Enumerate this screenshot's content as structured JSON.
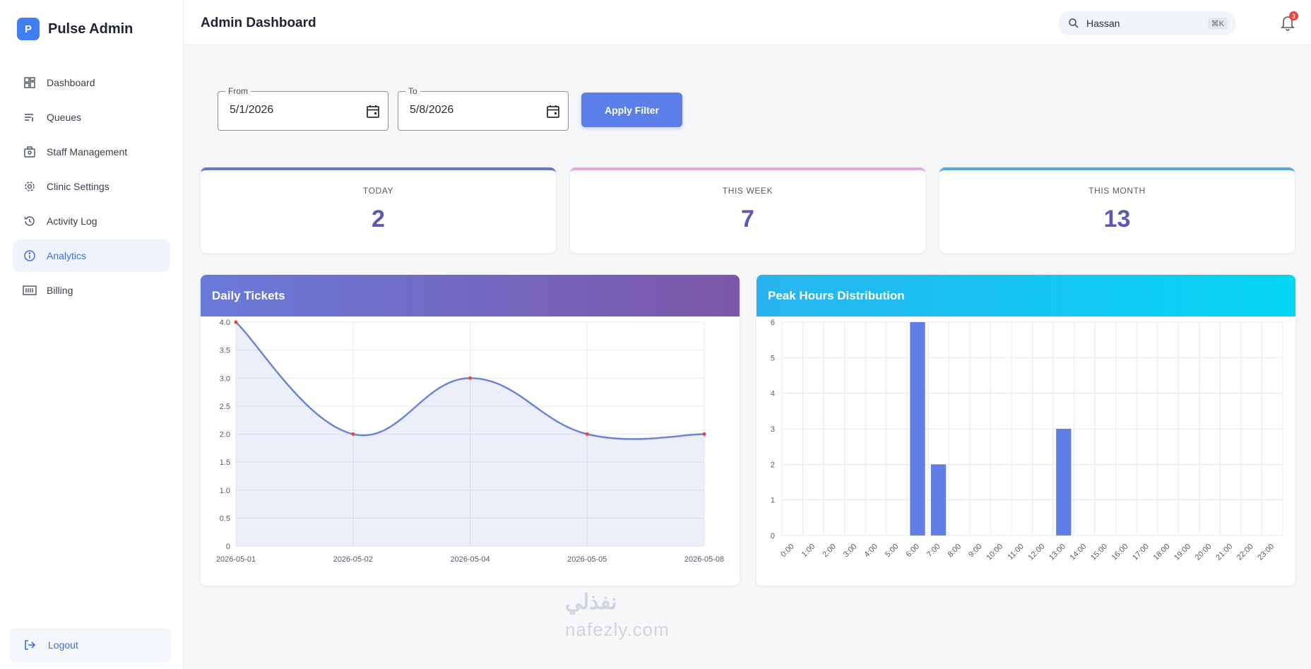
{
  "brand": {
    "logo_letter": "P",
    "name": "Pulse Admin"
  },
  "sidebar": {
    "items": [
      {
        "label": "Dashboard",
        "icon": "dashboard-icon"
      },
      {
        "label": "Queues",
        "icon": "queue-icon"
      },
      {
        "label": "Staff Management",
        "icon": "staff-icon"
      },
      {
        "label": "Clinic Settings",
        "icon": "gear-icon"
      },
      {
        "label": "Activity Log",
        "icon": "history-icon"
      },
      {
        "label": "Analytics",
        "icon": "info-icon",
        "active": true
      },
      {
        "label": "Billing",
        "icon": "billing-icon"
      }
    ],
    "logout_label": "Logout"
  },
  "header": {
    "title": "Admin Dashboard",
    "search_value": "Hassan",
    "search_shortcut": "⌘K",
    "notification_count": "3"
  },
  "filters": {
    "from_label": "From",
    "from_value": "5/1/2026",
    "to_label": "To",
    "to_value": "5/8/2026",
    "apply_label": "Apply Filter"
  },
  "stats": [
    {
      "label": "TODAY",
      "value": "2",
      "color": "#6a75d8"
    },
    {
      "label": "THIS WEEK",
      "value": "7",
      "color": "#e2a6e6"
    },
    {
      "label": "THIS MONTH",
      "value": "13",
      "color": "#4ea8ec"
    }
  ],
  "colors": {
    "accent": "#5b7fe8",
    "line": "#6b84d8",
    "bar": "#5f7ee6"
  },
  "watermark": {
    "text": "نفذلي",
    "domain": "nafezly.com"
  },
  "chart_data": [
    {
      "type": "line",
      "title": "Daily Tickets",
      "x": [
        "2026-05-01",
        "2026-05-02",
        "2026-05-04",
        "2026-05-05",
        "2026-05-08"
      ],
      "values": [
        4,
        2,
        3,
        2,
        2
      ],
      "ylim": [
        0,
        4
      ],
      "yticks": [
        "0",
        "0.5",
        "1.0",
        "1.5",
        "2.0",
        "2.5",
        "3.0",
        "3.5",
        "4.0"
      ],
      "fill": true,
      "grid": true
    },
    {
      "type": "bar",
      "title": "Peak Hours Distribution",
      "categories": [
        "0:00",
        "1:00",
        "2:00",
        "3:00",
        "4:00",
        "5:00",
        "6:00",
        "7:00",
        "8:00",
        "9:00",
        "10:00",
        "11:00",
        "12:00",
        "13:00",
        "14:00",
        "15:00",
        "16:00",
        "17:00",
        "18:00",
        "19:00",
        "20:00",
        "21:00",
        "22:00",
        "23:00"
      ],
      "values": [
        0,
        0,
        0,
        0,
        0,
        0,
        6,
        2,
        0,
        0,
        0,
        0,
        0,
        3,
        0,
        0,
        0,
        0,
        0,
        0,
        0,
        0,
        0,
        0
      ],
      "ylim": [
        0,
        6
      ],
      "yticks": [
        "0",
        "1",
        "2",
        "3",
        "4",
        "5",
        "6"
      ],
      "grid": true
    }
  ]
}
